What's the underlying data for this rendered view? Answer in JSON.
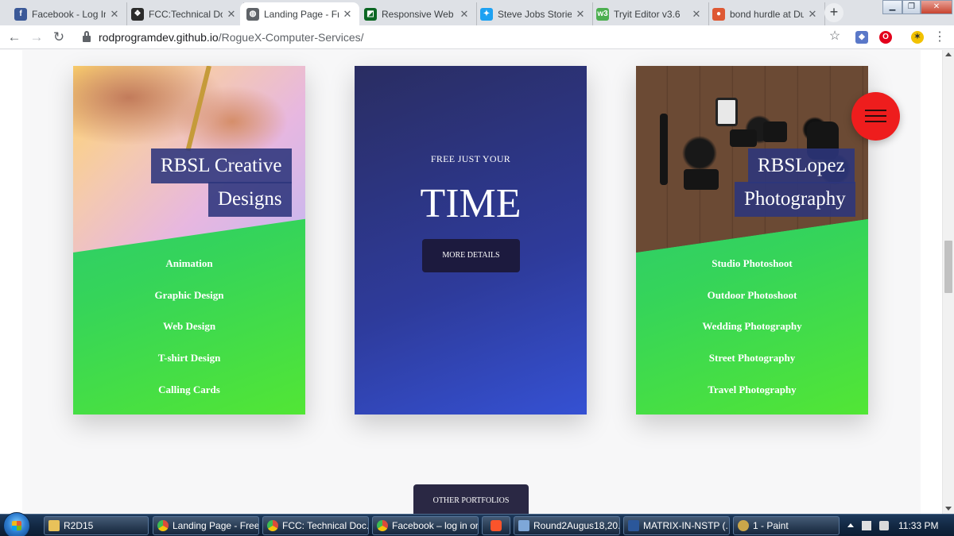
{
  "browser": {
    "tabs": [
      {
        "label": "Facebook - Log In o",
        "favicon": "facebook-icon",
        "color": "#3b5998",
        "glyph": "f",
        "active": false
      },
      {
        "label": "FCC:Technical Docu",
        "favicon": "freecodecamp-icon",
        "color": "#2b2b2b",
        "glyph": "❖",
        "active": false
      },
      {
        "label": "Landing Page - Fre",
        "favicon": "globe-icon",
        "color": "#5f6368",
        "glyph": "◍",
        "active": true
      },
      {
        "label": "Responsive Web D",
        "favicon": "codepen-icon",
        "color": "#0b6623",
        "glyph": "◩",
        "active": false
      },
      {
        "label": "Steve Jobs Stories",
        "favicon": "twitter-icon",
        "color": "#1da1f2",
        "glyph": "✦",
        "active": false
      },
      {
        "label": "Tryit Editor v3.6",
        "favicon": "w3schools-icon",
        "color": "#4caf50",
        "glyph": "w3",
        "active": false
      },
      {
        "label": "bond hurdle at Duc",
        "favicon": "duckduckgo-icon",
        "color": "#de5833",
        "glyph": "●",
        "active": false
      }
    ],
    "url_host": "rodprogramdev.github.io",
    "url_path": "/RogueX-Computer-Services/"
  },
  "cards": {
    "creative": {
      "title_line1": "RBSL Creative",
      "title_line2": "Designs",
      "services": [
        "Animation",
        "Graphic Design",
        "Web Design",
        "T-shirt Design",
        "Calling Cards"
      ]
    },
    "free": {
      "subtitle": "FREE JUST YOUR",
      "headline": "TIME",
      "button": "MORE DETAILS"
    },
    "photography": {
      "title_line1": "RBSLopez",
      "title_line2": "Photography",
      "services": [
        "Studio Photoshoot",
        "Outdoor Photoshoot",
        "Wedding Photography",
        "Street Photography",
        "Travel Photography"
      ]
    }
  },
  "other_portfolios_button": "OTHER PORTFOLIOS",
  "colors": {
    "accent_red": "#ee1d1d",
    "card_green_start": "#26c281",
    "card_green_end": "#52e635",
    "card_blue_start": "#2a2d62",
    "card_blue_end": "#3551d3",
    "title_box": "#2c367c"
  },
  "taskbar": {
    "items": [
      {
        "label": "R2D15",
        "icon": "folder-icon",
        "color": "#e8c25a"
      },
      {
        "label": "Landing Page - Free...",
        "icon": "chrome-icon",
        "color": "#dd4b39"
      },
      {
        "label": "FCC: Technical Doc...",
        "icon": "chrome-icon",
        "color": "#dd4b39"
      },
      {
        "label": "Facebook – log in or...",
        "icon": "chrome-icon",
        "color": "#dd4b39"
      },
      {
        "label": "",
        "icon": "brave-icon",
        "color": "#fb542b"
      },
      {
        "label": "Round2Augus18,20...",
        "icon": "document-icon",
        "color": "#7ea7d8"
      },
      {
        "label": "MATRIX-IN-NSTP (...",
        "icon": "word-icon",
        "color": "#2b579a"
      },
      {
        "label": "1 - Paint",
        "icon": "paint-icon",
        "color": "#c9a64a"
      }
    ],
    "time": "11:33 PM"
  }
}
